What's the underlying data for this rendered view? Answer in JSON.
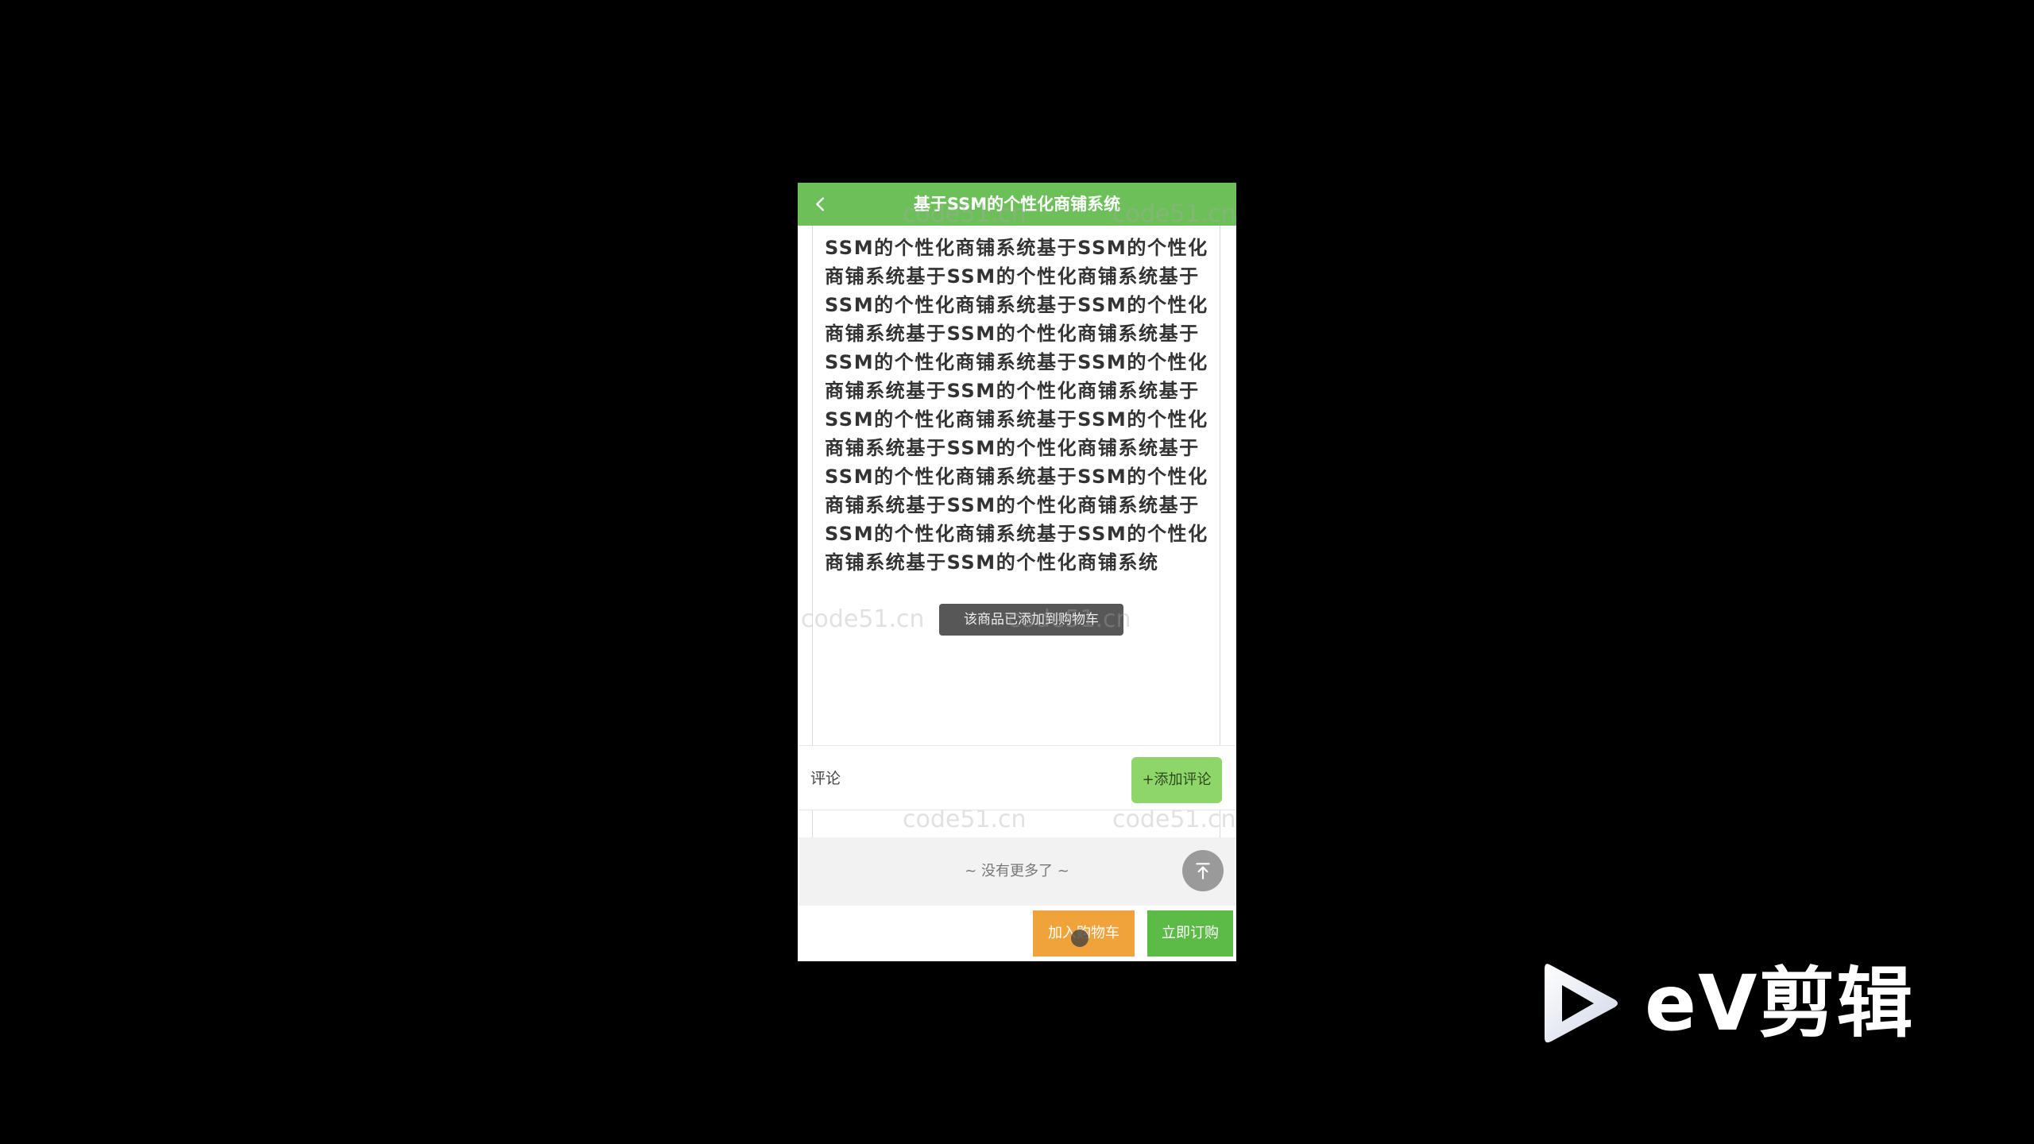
{
  "header": {
    "title": "基于SSM的个性化商铺系统",
    "back_icon": "chevron-left-icon"
  },
  "description": {
    "text": "SSM的个性化商铺系统基于SSM的个性化商铺系统基于SSM的个性化商铺系统基于SSM的个性化商铺系统基于SSM的个性化商铺系统基于SSM的个性化商铺系统基于SSM的个性化商铺系统基于SSM的个性化商铺系统基于SSM的个性化商铺系统基于SSM的个性化商铺系统基于SSM的个性化商铺系统基于SSM的个性化商铺系统基于SSM的个性化商铺系统基于SSM的个性化商铺系统基于SSM的个性化商铺系统基于SSM的个性化商铺系统基于SSM的个性化商铺系统基于SSM的个性化商铺系统"
  },
  "toast": {
    "text": "该商品已添加到购物车"
  },
  "comments": {
    "label": "评论",
    "add_button": "+添加评论"
  },
  "list_end": {
    "text": "~ 没有更多了 ~",
    "scroll_top_icon": "arrow-up-to-top-icon"
  },
  "actions": {
    "add_to_cart": "加入购物车",
    "order_now": "立即订购"
  },
  "watermark": {
    "text": "code51.cn"
  },
  "brand": {
    "name": "eV剪辑",
    "icon": "play-triangle-icon"
  },
  "colors": {
    "header_green": "#6dbf5a",
    "add_comment_green": "#8fd66a",
    "cart_orange": "#f0a33a",
    "order_green": "#5cba47"
  }
}
